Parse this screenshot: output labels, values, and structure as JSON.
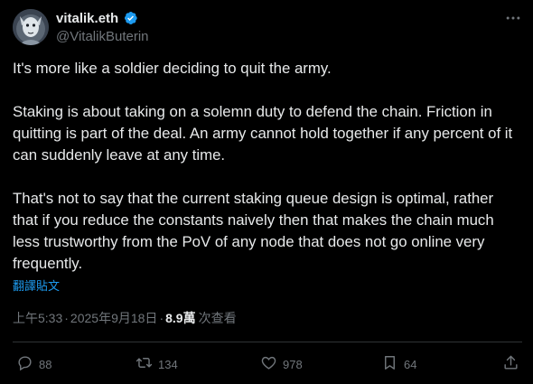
{
  "author": {
    "display_name": "vitalik.eth",
    "handle": "@VitalikButerin",
    "verified": true
  },
  "tweet": {
    "paragraphs": [
      "It's more like a soldier deciding to quit the army.",
      "Staking is about taking on a solemn duty to defend the chain. Friction in quitting is part of the deal. An army cannot hold together if any percent of it can suddenly leave at any time.",
      "That's not to say that the current staking queue design is optimal, rather that if you reduce the constants naively then that makes the chain much less trustworthy from the PoV of any node that does not go online very frequently."
    ],
    "translate_label": "翻譯貼文"
  },
  "meta": {
    "time": "上午5:33",
    "separator": "·",
    "date": "2025年9月18日",
    "views_count": "8.9萬",
    "views_label": "次查看"
  },
  "actions": {
    "reply_count": "88",
    "retweet_count": "134",
    "like_count": "978",
    "bookmark_count": "64"
  },
  "colors": {
    "background": "#000000",
    "text": "#e7e9ea",
    "secondary": "#71767b",
    "accent": "#1d9bf0",
    "divider": "#2f3336"
  },
  "icons": [
    "verified-badge-icon",
    "more-options-icon",
    "reply-icon",
    "retweet-icon",
    "like-icon",
    "bookmark-icon",
    "share-icon"
  ]
}
